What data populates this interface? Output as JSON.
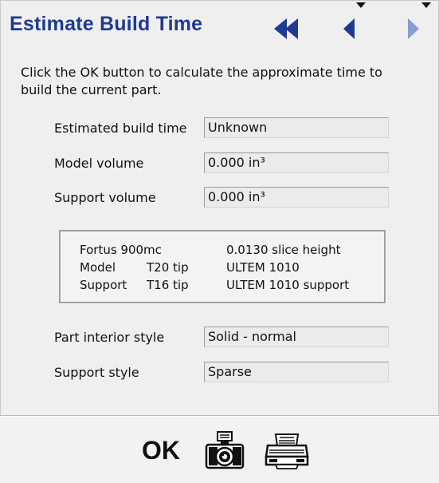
{
  "header": {
    "title": "Estimate Build Time",
    "nav": [
      {
        "icon": "double-triangle-left-icon",
        "color": "#1f3a93"
      },
      {
        "icon": "triangle-left-icon",
        "color": "#1f3a93"
      },
      {
        "icon": "triangle-right-icon",
        "color": "#8b9bd1"
      }
    ],
    "accent": "#1f3a93"
  },
  "instructions": "Click the OK button to calculate the approximate time to build the current part.",
  "fields_top": [
    {
      "label": "Estimated build time",
      "value": "Unknown"
    },
    {
      "label": "Model volume",
      "value": "0.000 in³"
    },
    {
      "label": "Support volume",
      "value": "0.000 in³"
    }
  ],
  "info": {
    "rows": [
      {
        "left": "Fortus 900mc",
        "tip": "",
        "right": "0.0130 slice height"
      },
      {
        "left": "Model",
        "tip": "T20 tip",
        "right": "ULTEM 1010"
      },
      {
        "left": "Support",
        "tip": "T16 tip",
        "right": "ULTEM 1010 support"
      }
    ]
  },
  "fields_bottom": [
    {
      "label": "Part interior style",
      "value": "Solid - normal"
    },
    {
      "label": "Support style",
      "value": "Sparse"
    }
  ],
  "footer": {
    "ok_label": "OK",
    "camera_icon": "camera-icon",
    "printer_icon": "printer-icon"
  }
}
